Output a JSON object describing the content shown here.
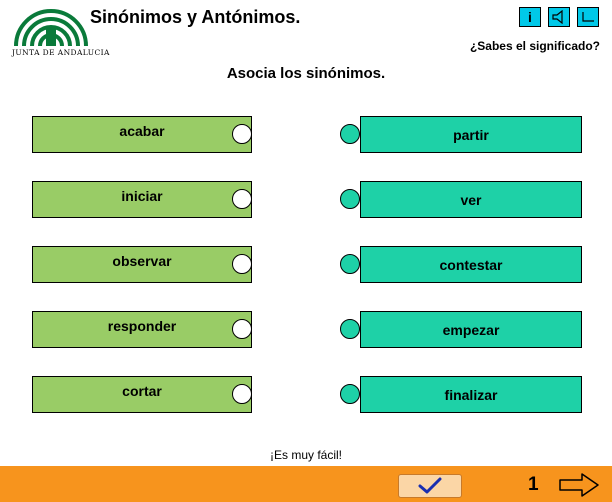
{
  "header": {
    "logo_text": "JUNTA DE ANDALUCIA",
    "title": "Sinónimos y Antónimos.",
    "toolbar": {
      "info_label": "i",
      "info_icon": "info-icon",
      "sound_icon": "speaker-icon",
      "window_icon": "window-corner-icon"
    },
    "question": "¿Sabes el significado?"
  },
  "instruction": "Asocia los sinónimos.",
  "left_words": [
    "acabar",
    "iniciar",
    "observar",
    "responder",
    "cortar"
  ],
  "right_words": [
    "partir",
    "ver",
    "contestar",
    "empezar",
    "finalizar"
  ],
  "footer_message": "¡Es muy fácil!",
  "bottom_bar": {
    "check_icon": "checkmark-icon",
    "page_number": "1",
    "next_icon": "arrow-right-icon"
  },
  "colors": {
    "left_piece": "#99cc66",
    "right_piece": "#1ed1a7",
    "toolbar_button": "#00c8e8",
    "bottom_bar": "#f7941d",
    "logo_green": "#0a7a3a"
  }
}
